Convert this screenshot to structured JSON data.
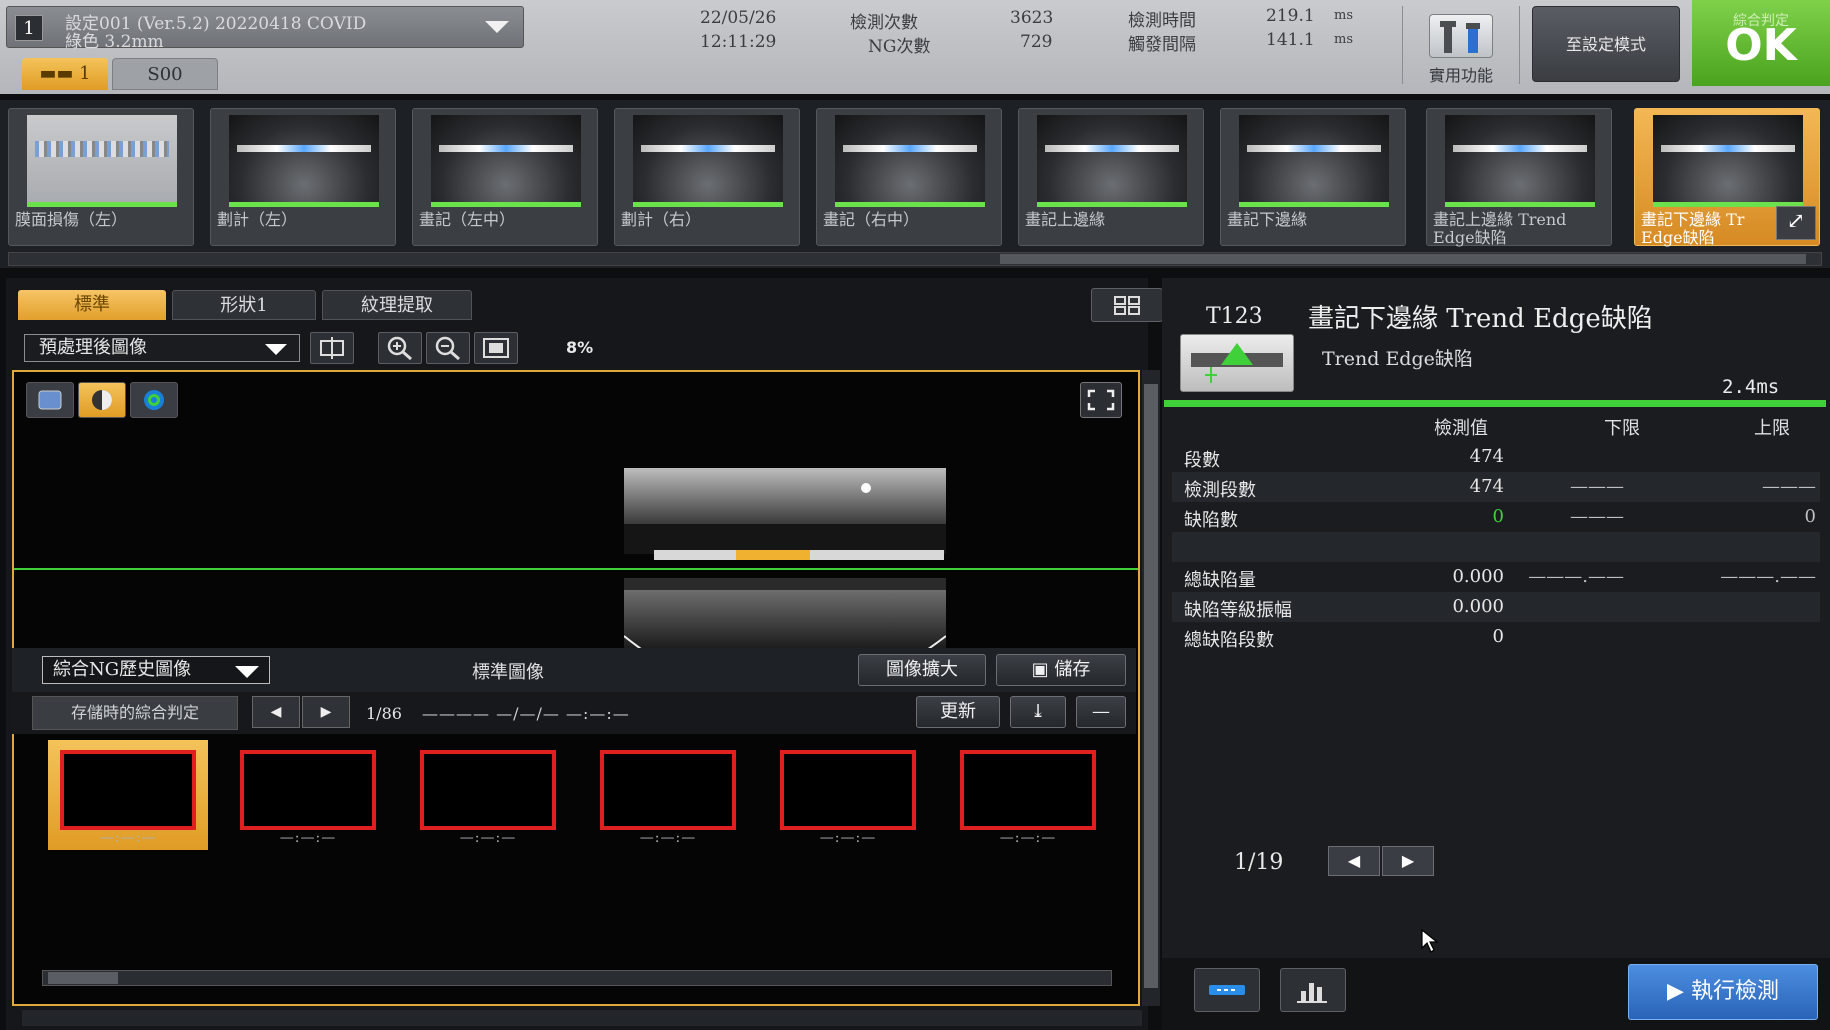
{
  "top": {
    "setting_no": "1",
    "setting_line1": "設定001 (Ver.5.2) 20220418 COVID",
    "setting_line2": "綠色 3.2mm",
    "date": "22/05/26",
    "time": "12:11:29",
    "count_label": "檢測次數",
    "count_value": "3623",
    "ng_label": "NG次數",
    "ng_value": "729",
    "mtime_label": "檢測時間",
    "mtime_value": "219.1",
    "mtime_unit": "ms",
    "interval_label": "觸發間隔",
    "interval_value": "141.1",
    "interval_unit": "ms",
    "tab1": "1",
    "tab2": "S00",
    "tools_label": "實用功能",
    "setmode_label": "至設定模式",
    "overall_small": "綜合判定",
    "overall_result": "OK"
  },
  "thumbs": [
    {
      "label": "膜面損傷（左）",
      "label2": ""
    },
    {
      "label": "劃計（左）",
      "label2": ""
    },
    {
      "label": "畫記（左中）",
      "label2": ""
    },
    {
      "label": "劃計（右）",
      "label2": ""
    },
    {
      "label": "畫記（右中）",
      "label2": ""
    },
    {
      "label": "畫記上邊緣",
      "label2": ""
    },
    {
      "label": "畫記下邊緣",
      "label2": ""
    },
    {
      "label": "畫記上邊緣 Trend",
      "label2": "Edge缺陷"
    },
    {
      "label": "畫記下邊緣 Tr",
      "label2": "Edge缺陷"
    }
  ],
  "viewer": {
    "tabs": [
      "標準",
      "形狀1",
      "紋理提取"
    ],
    "image_select": "預處理後圖像",
    "zoom": "8%",
    "history_select": "綜合NG歷史圖像",
    "history_title": "標準圖像",
    "enlarge_btn": "圖像擴大",
    "save_btn": "儲存",
    "judge_label": "存儲時的綜合判定",
    "nav_count": "1/86",
    "nav_date": "———— —/—/— —:—:—",
    "update_btn": "更新",
    "hist_times": [
      "—:—:—",
      "—:—:—",
      "—:—:—",
      "—:—:—",
      "—:—:—",
      "—:—:—"
    ]
  },
  "result": {
    "tool_id": "T123",
    "tool_name": "畫記下邊緣 Trend Edge缺陷",
    "tool_sub": "Trend Edge缺陷",
    "tool_ms": "2.4ms",
    "hdr_value": "檢測值",
    "hdr_low": "下限",
    "hdr_high": "上限",
    "rows": [
      {
        "label": "段數",
        "value": "474",
        "low": "",
        "high": ""
      },
      {
        "label": "檢測段數",
        "value": "474",
        "low": "———",
        "high": "———"
      },
      {
        "label": "缺陷數",
        "value": "0",
        "low": "———",
        "high": "0"
      },
      {
        "label": "",
        "value": "",
        "low": "",
        "high": ""
      },
      {
        "label": "總缺陷量",
        "value": "0.000",
        "low": "———.——",
        "high": "———.——"
      },
      {
        "label": "缺陷等級振幅",
        "value": "0.000",
        "low": "",
        "high": ""
      },
      {
        "label": "總缺陷段數",
        "value": "0",
        "low": "",
        "high": ""
      }
    ],
    "page": "1/19",
    "run_btn": "執行檢測"
  },
  "colors": {
    "accent": "#e0a93a",
    "ok": "#4aa31e",
    "pass_green": "#3fd03a",
    "ng_red": "#e02020"
  }
}
